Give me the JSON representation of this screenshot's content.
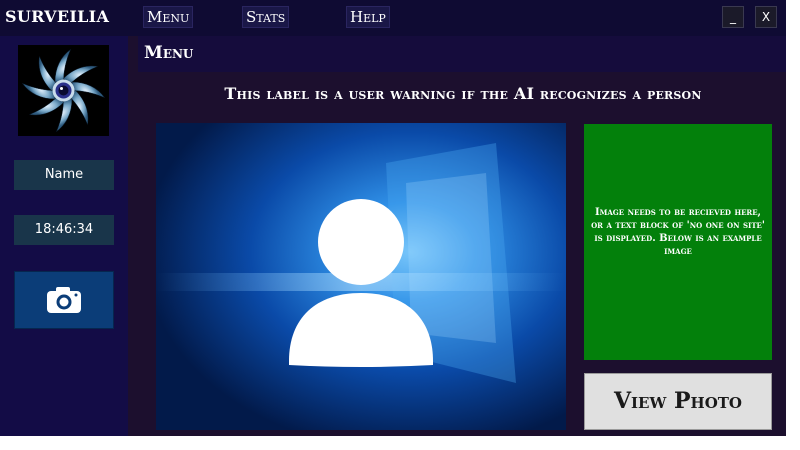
{
  "app": {
    "title": "SURVEILIA"
  },
  "menubar": {
    "items": [
      "Menu",
      "Stats",
      "Help"
    ]
  },
  "window_controls": {
    "minimize": "_",
    "close": "X"
  },
  "sidebar": {
    "name_label": "Name",
    "time": "18:46:34",
    "camera_icon": "camera-icon",
    "logo_icon": "spiral-eye-logo"
  },
  "main": {
    "title": "Menu",
    "warning": "This label is a user warning if the AI recognizes a person",
    "info_text": "Image needs to be recieved here, or a text block of 'no one on site' is displayed. Below is an example image",
    "view_photo": "View Photo"
  },
  "colors": {
    "titlebar": "#0f0b33",
    "sidebar": "#130c46",
    "main_bg": "#1c0f2e",
    "info_green": "#03800b",
    "camera_button": "#0b3d78"
  }
}
